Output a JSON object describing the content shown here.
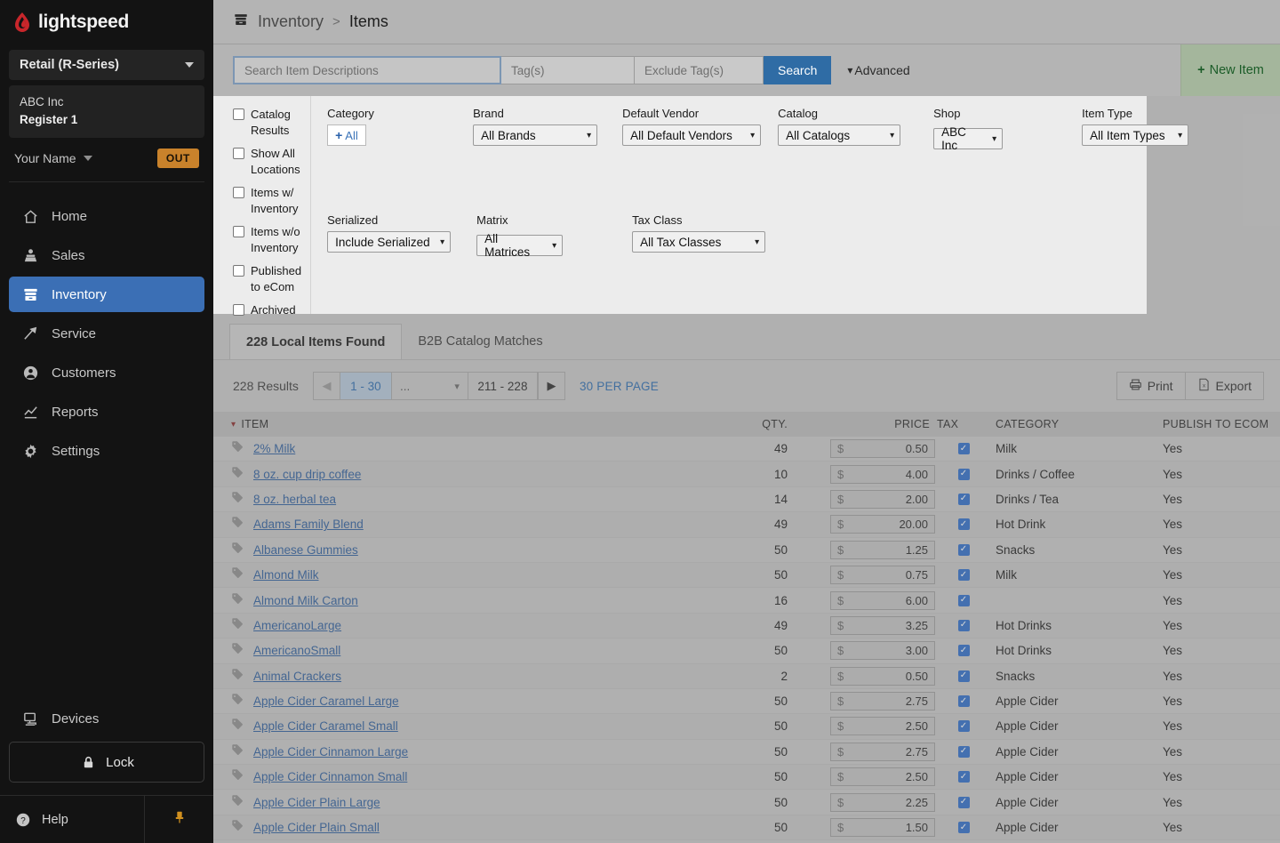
{
  "brand": {
    "name": "lightspeed"
  },
  "sidebar": {
    "product_selector": {
      "label": "Retail (R-Series)",
      "icon": "chevron-down-icon"
    },
    "shop": {
      "name": "ABC Inc",
      "register": "Register 1"
    },
    "user": {
      "name": "Your Name",
      "status_badge": "OUT",
      "badge_color": "#c9822b"
    },
    "nav_items": [
      {
        "label": "Home",
        "icon": "home-icon",
        "active": false
      },
      {
        "label": "Sales",
        "icon": "sales-icon",
        "active": false
      },
      {
        "label": "Inventory",
        "icon": "inventory-icon",
        "active": true
      },
      {
        "label": "Service",
        "icon": "service-icon",
        "active": false
      },
      {
        "label": "Customers",
        "icon": "customers-icon",
        "active": false
      },
      {
        "label": "Reports",
        "icon": "reports-icon",
        "active": false
      },
      {
        "label": "Settings",
        "icon": "settings-icon",
        "active": false
      }
    ],
    "devices": {
      "label": "Devices",
      "icon": "devices-icon"
    },
    "lock": {
      "label": "Lock",
      "icon": "lock-icon"
    },
    "help": {
      "label": "Help",
      "icon": "help-icon"
    },
    "pin": {
      "icon": "pin-icon"
    },
    "active_accent": "#3b6fb5"
  },
  "breadcrumb": {
    "section": "Inventory",
    "separator": ">",
    "current": "Items",
    "icon": "inventory-icon"
  },
  "search": {
    "query_placeholder": "Search Item Descriptions",
    "query_value": "",
    "tags_placeholder": "Tag(s)",
    "exclude_tags_placeholder": "Exclude Tag(s)",
    "search_button": "Search",
    "advanced_toggle": "Advanced",
    "new_item_button": "New Item",
    "search_button_color": "#2f6ca5"
  },
  "advanced_panel": {
    "checkboxes": [
      {
        "label": "Catalog Results",
        "checked": false
      },
      {
        "label": "Show All Locations",
        "checked": false
      },
      {
        "label": "Items w/ Inventory",
        "checked": false
      },
      {
        "label": "Items w/o Inventory",
        "checked": false
      },
      {
        "label": "Published to eCom",
        "checked": false
      },
      {
        "label": "Archived",
        "checked": false
      }
    ],
    "category": {
      "label": "Category",
      "button_label": "All"
    },
    "brand": {
      "label": "Brand",
      "value": "All Brands"
    },
    "default_vendor": {
      "label": "Default Vendor",
      "value": "All Default Vendors"
    },
    "catalog": {
      "label": "Catalog",
      "value": "All Catalogs"
    },
    "shop": {
      "label": "Shop",
      "value": "ABC Inc"
    },
    "item_type": {
      "label": "Item Type",
      "value": "All Item Types"
    },
    "serialized": {
      "label": "Serialized",
      "value": "Include Serialized"
    },
    "matrix": {
      "label": "Matrix",
      "value": "All Matrices"
    },
    "tax_class": {
      "label": "Tax Class",
      "value": "All Tax Classes"
    }
  },
  "tabs": [
    {
      "label": "228 Local Items Found",
      "active": true
    },
    {
      "label": "B2B Catalog Matches",
      "active": false
    }
  ],
  "pagination": {
    "results_label": "228 Results",
    "prev_icon": "triangle-left-icon",
    "current_page": "1 - 30",
    "dots": "...",
    "dropdown_icon": "triangle-down-icon",
    "last_page": "211 - 228",
    "next_icon": "triangle-right-icon",
    "per_page": "30 PER PAGE"
  },
  "actions": {
    "print": {
      "label": "Print",
      "icon": "printer-icon"
    },
    "export": {
      "label": "Export",
      "icon": "spreadsheet-icon"
    }
  },
  "table": {
    "columns": [
      "ITEM",
      "QTY.",
      "PRICE",
      "TAX",
      "CATEGORY",
      "PUBLISH TO ECOM"
    ],
    "sort_column": "ITEM",
    "sort_icon": "caret-down-icon",
    "currency_symbol": "$",
    "rows": [
      {
        "item": "2% Milk",
        "qty": "49",
        "price": "0.50",
        "tax": true,
        "category": "Milk",
        "publish": "Yes"
      },
      {
        "item": "8 oz. cup drip coffee",
        "qty": "10",
        "price": "4.00",
        "tax": true,
        "category": "Drinks / Coffee",
        "publish": "Yes"
      },
      {
        "item": "8 oz. herbal tea",
        "qty": "14",
        "price": "2.00",
        "tax": true,
        "category": "Drinks / Tea",
        "publish": "Yes"
      },
      {
        "item": "Adams Family Blend",
        "qty": "49",
        "price": "20.00",
        "tax": true,
        "category": "Hot Drink",
        "publish": "Yes"
      },
      {
        "item": "Albanese Gummies",
        "qty": "50",
        "price": "1.25",
        "tax": true,
        "category": "Snacks",
        "publish": "Yes"
      },
      {
        "item": "Almond Milk",
        "qty": "50",
        "price": "0.75",
        "tax": true,
        "category": "Milk",
        "publish": "Yes"
      },
      {
        "item": "Almond Milk Carton",
        "qty": "16",
        "price": "6.00",
        "tax": true,
        "category": "",
        "publish": "Yes"
      },
      {
        "item": "AmericanoLarge",
        "qty": "49",
        "price": "3.25",
        "tax": true,
        "category": "Hot Drinks",
        "publish": "Yes"
      },
      {
        "item": "AmericanoSmall",
        "qty": "50",
        "price": "3.00",
        "tax": true,
        "category": "Hot Drinks",
        "publish": "Yes"
      },
      {
        "item": "Animal Crackers",
        "qty": "2",
        "price": "0.50",
        "tax": true,
        "category": "Snacks",
        "publish": "Yes"
      },
      {
        "item": "Apple Cider Caramel Large",
        "qty": "50",
        "price": "2.75",
        "tax": true,
        "category": "Apple Cider",
        "publish": "Yes"
      },
      {
        "item": "Apple Cider Caramel Small",
        "qty": "50",
        "price": "2.50",
        "tax": true,
        "category": "Apple Cider",
        "publish": "Yes"
      },
      {
        "item": "Apple Cider Cinnamon Large",
        "qty": "50",
        "price": "2.75",
        "tax": true,
        "category": "Apple Cider",
        "publish": "Yes"
      },
      {
        "item": "Apple Cider Cinnamon Small",
        "qty": "50",
        "price": "2.50",
        "tax": true,
        "category": "Apple Cider",
        "publish": "Yes"
      },
      {
        "item": "Apple Cider Plain Large",
        "qty": "50",
        "price": "2.25",
        "tax": true,
        "category": "Apple Cider",
        "publish": "Yes"
      },
      {
        "item": "Apple Cider Plain Small",
        "qty": "50",
        "price": "1.50",
        "tax": true,
        "category": "Apple Cider",
        "publish": "Yes"
      }
    ]
  }
}
